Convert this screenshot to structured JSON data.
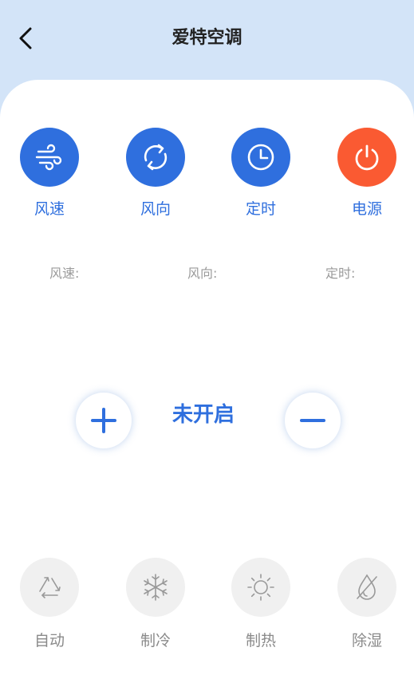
{
  "header": {
    "title": "爱特空调"
  },
  "controls": [
    {
      "label": "风速",
      "icon": "wind-icon",
      "color": "#2f6fde"
    },
    {
      "label": "风向",
      "icon": "cycle-icon",
      "color": "#2f6fde"
    },
    {
      "label": "定时",
      "icon": "clock-icon",
      "color": "#2f6fde"
    },
    {
      "label": "电源",
      "icon": "power-icon",
      "color": "#fa5a32"
    }
  ],
  "status": {
    "speed": "风速:",
    "direction": "风向:",
    "timer": "定时:"
  },
  "state": {
    "text": "未开启"
  },
  "modes": [
    {
      "label": "自动",
      "icon": "auto-cycle-icon"
    },
    {
      "label": "制冷",
      "icon": "snowflake-icon"
    },
    {
      "label": "制热",
      "icon": "sun-icon"
    },
    {
      "label": "除湿",
      "icon": "dehumidify-icon"
    }
  ]
}
